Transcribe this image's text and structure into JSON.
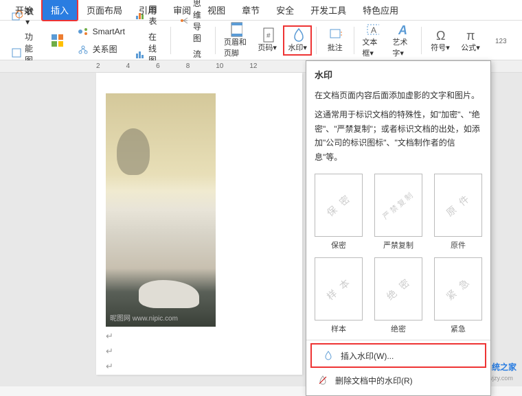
{
  "tabs": [
    "开始",
    "插入",
    "页面布局",
    "引用",
    "审阅",
    "视图",
    "章节",
    "安全",
    "开发工具",
    "特色应用"
  ],
  "active_tab": 1,
  "ribbon": {
    "shape_label": "状▾",
    "func_label": "功能图▾",
    "smartart": "SmartArt",
    "relation": "关系图",
    "chart_label": "图表",
    "online_chart": "在线图表",
    "mind_map": "思维导图",
    "flow_chart": "流程图",
    "header_footer": "页眉和页脚",
    "page_num": "页码▾",
    "watermark": "水印▾",
    "comment": "批注",
    "textbox": "文本框▾",
    "wordart": "艺术字▾",
    "symbol": "符号▾",
    "formula": "公式▾"
  },
  "ruler_marks": [
    "2",
    "4",
    "6",
    "8",
    "10",
    "12"
  ],
  "tooltip": {
    "title": "水印",
    "p1": "在文档页面内容后面添加虚影的文字和图片。",
    "p2": "这通常用于标识文档的特殊性，如\"加密\"、\"绝密\"、\"严禁复制\"；或者标识文档的出处，如添加\"公司的标识图标\"、\"文档制作者的信息\"等。"
  },
  "presets": [
    {
      "wm": "保 密",
      "label": "保密"
    },
    {
      "wm": "严禁复制",
      "label": "严禁复制"
    },
    {
      "wm": "原 件",
      "label": "原件"
    },
    {
      "wm": "样 本",
      "label": "样本"
    },
    {
      "wm": "绝 密",
      "label": "绝密"
    },
    {
      "wm": "紧 急",
      "label": "紧急"
    }
  ],
  "menu": {
    "insert": "插入水印(W)...",
    "remove": "删除文档中的水印(R)"
  },
  "img_credit": "昵图网 www.nipic.com",
  "brand": "纯净系统之家",
  "brand_url": "www.ycwjzy.com"
}
